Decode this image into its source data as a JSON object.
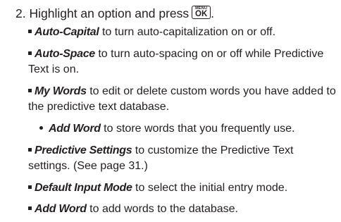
{
  "step": {
    "text": "2. Highlight an option and press",
    "key_top": "MENU",
    "key_main": "OK",
    "end": "."
  },
  "items": [
    {
      "term": "Auto-Capital",
      "desc": " to turn auto-capitalization on or off."
    },
    {
      "term": "Auto-Space",
      "desc": " to turn auto-spacing on or off while Predictive Text is on."
    },
    {
      "term": "My Words",
      "desc": " to edit or delete custom words you have added to the predictive text database."
    },
    {
      "term": "Add Word",
      "desc": " to store words that you frequently use."
    },
    {
      "term": "Predictive Settings",
      "desc": " to customize the Predictive Text settings. (See page 31.)"
    },
    {
      "term": "Default Input Mode",
      "desc": " to select the initial entry mode."
    },
    {
      "term": "Add Word",
      "desc": " to add words to the database."
    }
  ]
}
